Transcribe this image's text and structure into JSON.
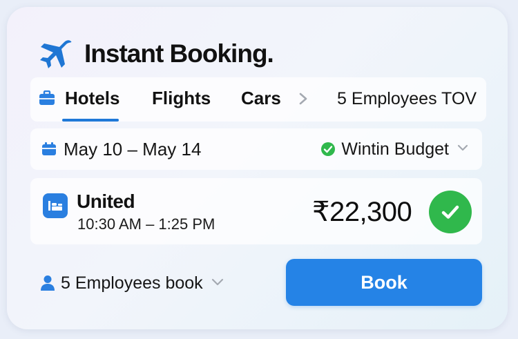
{
  "header": {
    "title": "Instant Booking.",
    "icon": "airplane-icon"
  },
  "tabs": [
    {
      "label": "Hotels",
      "icon": "briefcase-icon",
      "selected": true
    },
    {
      "label": "Flights",
      "selected": false
    },
    {
      "label": "Cars",
      "selected": false
    }
  ],
  "tabs_more": "5 Employees TOV",
  "dates": {
    "range": "May 10 – May 14",
    "icon": "calendar-icon"
  },
  "budget": {
    "label": "Wintin Budget",
    "status_icon": "check-circle-icon"
  },
  "flight": {
    "airline": "United",
    "time": "10:30 AM – 1:25 PM",
    "price": "₹22,300",
    "icon": "airline-icon"
  },
  "employees": {
    "label": "5 Employees book",
    "icon": "person-icon"
  },
  "book_button": {
    "label": "Book"
  },
  "colors": {
    "accent": "#2583e6",
    "success": "#30b84c",
    "chevron": "#a4a9b1"
  }
}
